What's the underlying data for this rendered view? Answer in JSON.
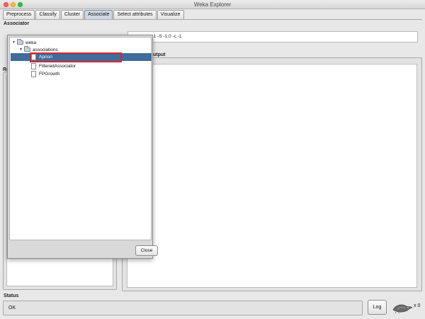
{
  "window": {
    "title": "Weka Explorer"
  },
  "tabs": [
    "Preprocess",
    "Classify",
    "Cluster",
    "Associate",
    "Select attributes",
    "Visualize"
  ],
  "active_tab": "Associate",
  "associator": {
    "section_label": "Associator",
    "command_text": ".1 -S -1.0 -c -1"
  },
  "result_list": {
    "label_fragment": "Re"
  },
  "output": {
    "label_fragment": "utput"
  },
  "chooser_popup": {
    "tree": {
      "root": "weka",
      "folder": "associations",
      "items": [
        "Apriori",
        "FilteredAssociator",
        "FPGrowth"
      ],
      "selected": "Apriori"
    },
    "close_label": "Close"
  },
  "status": {
    "section_label": "Status",
    "text": "OK"
  },
  "log_button": "Log",
  "task_count": "x 0"
}
